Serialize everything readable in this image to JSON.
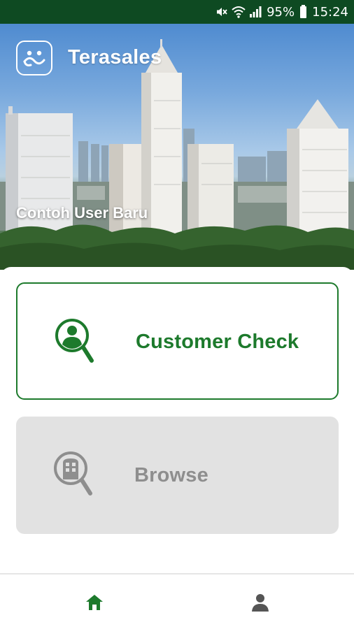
{
  "status_bar": {
    "battery": "95%",
    "time": "15:24",
    "icons": [
      "mute-icon",
      "wifi-icon",
      "signal-icon",
      "battery-icon"
    ]
  },
  "header": {
    "app_name": "Terasales",
    "logo_icon": "terasales-logo-icon",
    "user_name": "Contoh User Baru"
  },
  "menu": {
    "customer_check": {
      "label": "Customer Check",
      "icon": "person-search-icon",
      "color": "#1d7a2c"
    },
    "browse": {
      "label": "Browse",
      "icon": "building-search-icon",
      "color": "#8e8e8e"
    }
  },
  "bottom_nav": {
    "items": [
      {
        "name": "home",
        "icon": "home-icon",
        "active": true,
        "color": "#1d7a2c"
      },
      {
        "name": "profile",
        "icon": "person-icon",
        "active": false,
        "color": "#555555"
      }
    ]
  },
  "colors": {
    "status_bar": "#0e4a22",
    "accent": "#1d7a2c",
    "disabled_card": "#e2e2e2"
  }
}
